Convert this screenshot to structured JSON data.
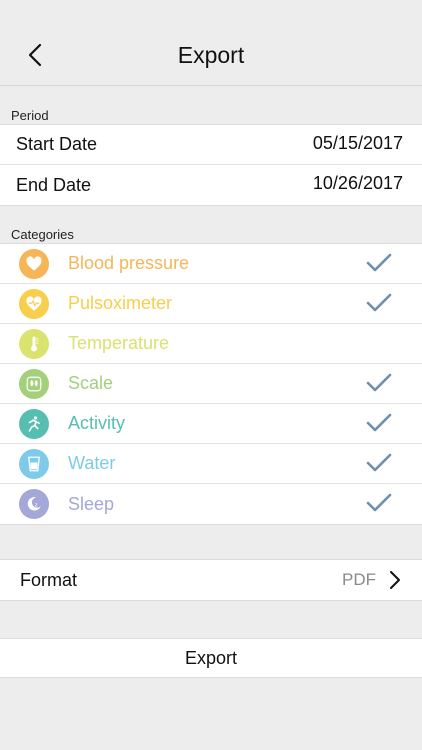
{
  "header": {
    "title": "Export"
  },
  "period": {
    "section_label": "Period",
    "start_label": "Start Date",
    "start_value": "05/15/2017",
    "end_label": "End Date",
    "end_value": "10/26/2017"
  },
  "categories": {
    "section_label": "Categories",
    "items": [
      {
        "name": "Blood pressure",
        "color": "#f6b557",
        "icon": "heart-icon",
        "checked": true
      },
      {
        "name": "Pulsoximeter",
        "color": "#f7cf4d",
        "icon": "pulse-heart-icon",
        "checked": true
      },
      {
        "name": "Temperature",
        "color": "#d9e36d",
        "icon": "thermometer-icon",
        "checked": false
      },
      {
        "name": "Scale",
        "color": "#a4cf7b",
        "icon": "footprints-icon",
        "checked": true
      },
      {
        "name": "Activity",
        "color": "#56bfb1",
        "icon": "runner-icon",
        "checked": true
      },
      {
        "name": "Water",
        "color": "#7dcbe9",
        "icon": "glass-icon",
        "checked": true
      },
      {
        "name": "Sleep",
        "color": "#a4a7d8",
        "icon": "moon-icon",
        "checked": true
      }
    ],
    "check_color": "#6f8fb0"
  },
  "format": {
    "label": "Format",
    "value": "PDF"
  },
  "export_button": {
    "label": "Export"
  }
}
